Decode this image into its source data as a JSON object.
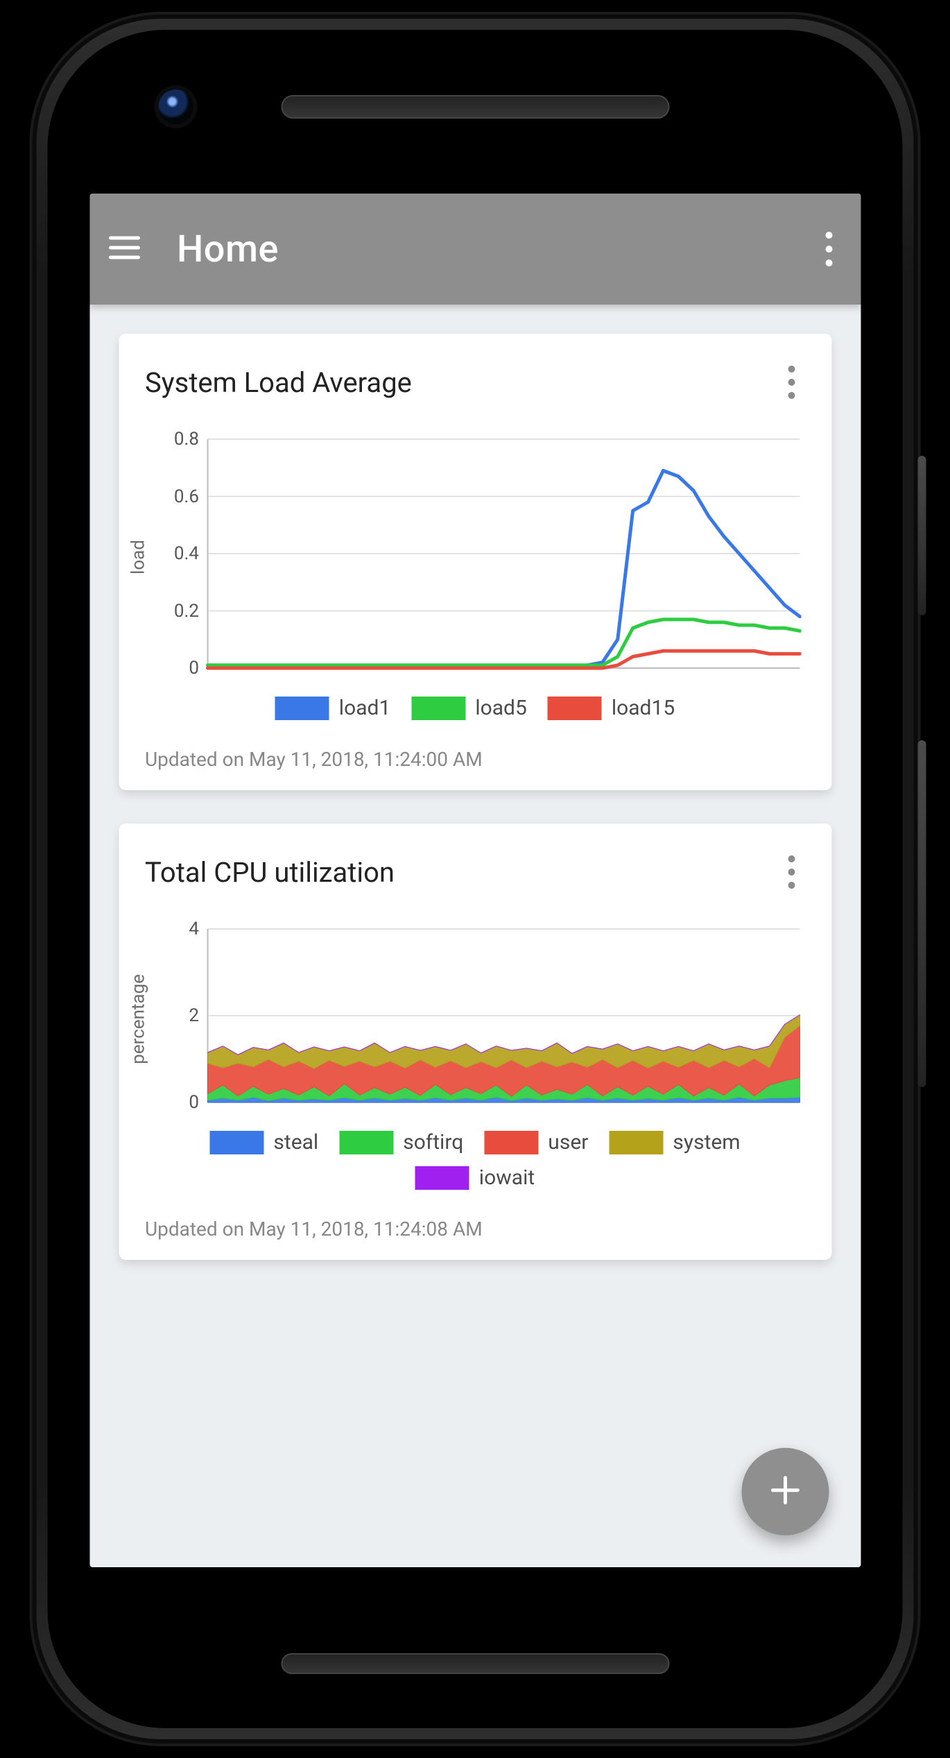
{
  "appbar": {
    "title": "Home"
  },
  "fab": {
    "icon": "plus"
  },
  "cards": [
    {
      "title": "System Load Average",
      "updated": "Updated on May 11, 2018, 11:24:00 AM",
      "legend": [
        {
          "name": "load1",
          "color": "#3b78e7"
        },
        {
          "name": "load5",
          "color": "#2ecc40"
        },
        {
          "name": "load15",
          "color": "#e74c3c"
        }
      ]
    },
    {
      "title": "Total CPU utilization",
      "updated": "Updated on May 11, 2018, 11:24:08 AM",
      "legend": [
        {
          "name": "steal",
          "color": "#3b78e7"
        },
        {
          "name": "softirq",
          "color": "#2ecc40"
        },
        {
          "name": "user",
          "color": "#e74c3c"
        },
        {
          "name": "system",
          "color": "#b5a21b"
        },
        {
          "name": "iowait",
          "color": "#a020f0"
        }
      ]
    }
  ],
  "chart_data": [
    {
      "type": "line",
      "title": "System Load Average",
      "xlabel": "",
      "ylabel": "load",
      "ylim": [
        0,
        0.8
      ],
      "y_ticks": [
        0,
        0.2,
        0.4,
        0.6,
        0.8
      ],
      "x": [
        0,
        1,
        2,
        3,
        4,
        5,
        6,
        7,
        8,
        9,
        10,
        11,
        12,
        13,
        14,
        15,
        16,
        17,
        18,
        19,
        20,
        21,
        22,
        23,
        24,
        25,
        26,
        27,
        28,
        29,
        30,
        31,
        32,
        33,
        34,
        35,
        36,
        37,
        38,
        39
      ],
      "series": [
        {
          "name": "load1",
          "color": "#3b78e7",
          "values": [
            0.01,
            0.01,
            0.01,
            0.01,
            0.01,
            0.01,
            0.01,
            0.01,
            0.01,
            0.01,
            0.01,
            0.01,
            0.01,
            0.01,
            0.01,
            0.01,
            0.01,
            0.01,
            0.01,
            0.01,
            0.01,
            0.01,
            0.01,
            0.01,
            0.01,
            0.01,
            0.02,
            0.1,
            0.55,
            0.58,
            0.69,
            0.67,
            0.62,
            0.53,
            0.46,
            0.4,
            0.34,
            0.28,
            0.22,
            0.18
          ]
        },
        {
          "name": "load5",
          "color": "#2ecc40",
          "values": [
            0.01,
            0.01,
            0.01,
            0.01,
            0.01,
            0.01,
            0.01,
            0.01,
            0.01,
            0.01,
            0.01,
            0.01,
            0.01,
            0.01,
            0.01,
            0.01,
            0.01,
            0.01,
            0.01,
            0.01,
            0.01,
            0.01,
            0.01,
            0.01,
            0.01,
            0.01,
            0.01,
            0.04,
            0.14,
            0.16,
            0.17,
            0.17,
            0.17,
            0.16,
            0.16,
            0.15,
            0.15,
            0.14,
            0.14,
            0.13
          ]
        },
        {
          "name": "load15",
          "color": "#e74c3c",
          "values": [
            0.0,
            0.0,
            0.0,
            0.0,
            0.0,
            0.0,
            0.0,
            0.0,
            0.0,
            0.0,
            0.0,
            0.0,
            0.0,
            0.0,
            0.0,
            0.0,
            0.0,
            0.0,
            0.0,
            0.0,
            0.0,
            0.0,
            0.0,
            0.0,
            0.0,
            0.0,
            0.0,
            0.01,
            0.04,
            0.05,
            0.06,
            0.06,
            0.06,
            0.06,
            0.06,
            0.06,
            0.06,
            0.05,
            0.05,
            0.05
          ]
        }
      ]
    },
    {
      "type": "area",
      "title": "Total CPU utilization",
      "xlabel": "",
      "ylabel": "percentage",
      "ylim": [
        0,
        4
      ],
      "y_ticks": [
        0,
        2,
        4
      ],
      "x": [
        0,
        1,
        2,
        3,
        4,
        5,
        6,
        7,
        8,
        9,
        10,
        11,
        12,
        13,
        14,
        15,
        16,
        17,
        18,
        19,
        20,
        21,
        22,
        23,
        24,
        25,
        26,
        27,
        28,
        29,
        30,
        31,
        32,
        33,
        34,
        35,
        36,
        37,
        38,
        39
      ],
      "series": [
        {
          "name": "steal",
          "color": "#3b78e7",
          "values": [
            0.05,
            0.1,
            0.05,
            0.12,
            0.04,
            0.1,
            0.05,
            0.08,
            0.05,
            0.11,
            0.05,
            0.1,
            0.05,
            0.09,
            0.05,
            0.11,
            0.05,
            0.1,
            0.05,
            0.12,
            0.04,
            0.1,
            0.05,
            0.08,
            0.05,
            0.11,
            0.05,
            0.1,
            0.05,
            0.09,
            0.05,
            0.11,
            0.05,
            0.1,
            0.05,
            0.12,
            0.05,
            0.1,
            0.1,
            0.12
          ]
        },
        {
          "name": "softirq",
          "color": "#2ecc40",
          "values": [
            0.15,
            0.3,
            0.1,
            0.25,
            0.15,
            0.22,
            0.12,
            0.28,
            0.1,
            0.32,
            0.12,
            0.24,
            0.14,
            0.26,
            0.11,
            0.3,
            0.13,
            0.24,
            0.15,
            0.28,
            0.1,
            0.3,
            0.12,
            0.22,
            0.14,
            0.3,
            0.1,
            0.26,
            0.12,
            0.28,
            0.14,
            0.3,
            0.1,
            0.24,
            0.12,
            0.3,
            0.1,
            0.3,
            0.4,
            0.45
          ]
        },
        {
          "name": "user",
          "color": "#e74c3c",
          "values": [
            0.7,
            0.4,
            0.75,
            0.45,
            0.8,
            0.5,
            0.78,
            0.42,
            0.82,
            0.4,
            0.78,
            0.48,
            0.76,
            0.44,
            0.82,
            0.4,
            0.78,
            0.46,
            0.74,
            0.4,
            0.84,
            0.4,
            0.78,
            0.52,
            0.74,
            0.4,
            0.84,
            0.44,
            0.8,
            0.42,
            0.76,
            0.4,
            0.82,
            0.46,
            0.8,
            0.4,
            0.86,
            0.4,
            1.0,
            1.2
          ]
        },
        {
          "name": "system",
          "color": "#b5a21b",
          "values": [
            0.25,
            0.5,
            0.2,
            0.45,
            0.22,
            0.55,
            0.2,
            0.5,
            0.22,
            0.45,
            0.24,
            0.55,
            0.2,
            0.5,
            0.22,
            0.48,
            0.24,
            0.55,
            0.2,
            0.5,
            0.22,
            0.45,
            0.24,
            0.55,
            0.2,
            0.48,
            0.24,
            0.55,
            0.22,
            0.5,
            0.24,
            0.48,
            0.22,
            0.55,
            0.24,
            0.48,
            0.2,
            0.5,
            0.3,
            0.25
          ]
        },
        {
          "name": "iowait",
          "color": "#a020f0",
          "values": [
            0,
            0,
            0,
            0,
            0,
            0,
            0,
            0,
            0,
            0,
            0,
            0,
            0,
            0,
            0,
            0,
            0,
            0,
            0,
            0,
            0,
            0,
            0,
            0,
            0,
            0,
            0,
            0,
            0,
            0,
            0,
            0,
            0,
            0,
            0,
            0,
            0,
            0,
            0,
            0
          ]
        }
      ]
    }
  ]
}
